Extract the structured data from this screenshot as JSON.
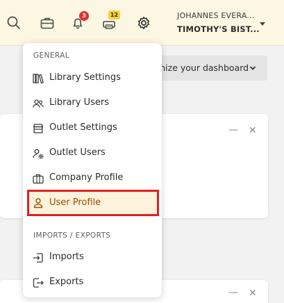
{
  "header": {
    "icons": [
      "search-icon",
      "briefcase-icon",
      "bell-icon",
      "printer-icon",
      "gear-icon"
    ],
    "notifications_count": "3",
    "printer_count": "12",
    "user_name": "JOHANNES EVERA...",
    "outlet_name": "TIMOTHY'S BIST...",
    "accent_color": "#f7d13a",
    "badge_color": "#e23232"
  },
  "dashboard": {
    "customize_label": "mize your dashboard"
  },
  "menu": {
    "general_label": "GENERAL",
    "items": [
      {
        "label": "Library Settings",
        "icon": "library-icon"
      },
      {
        "label": "Library Users",
        "icon": "users-icon"
      },
      {
        "label": "Outlet Settings",
        "icon": "store-icon"
      },
      {
        "label": "Outlet Users",
        "icon": "user-gear-icon"
      },
      {
        "label": "Company Profile",
        "icon": "briefcase-icon"
      },
      {
        "label": "User Profile",
        "icon": "user-icon",
        "active": true
      }
    ],
    "imports_exports_label": "IMPORTS / EXPORTS",
    "io_items": [
      {
        "label": "Imports",
        "icon": "import-icon"
      },
      {
        "label": "Exports",
        "icon": "export-icon"
      }
    ],
    "active_color": "#9a4d00",
    "highlight_border_color": "#e02020"
  }
}
